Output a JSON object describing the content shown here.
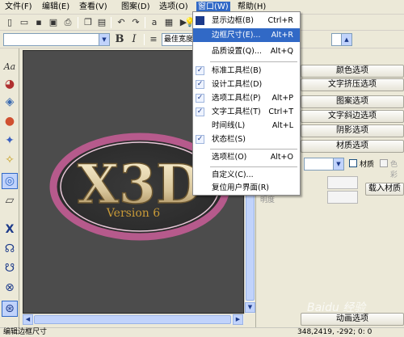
{
  "menubar": {
    "items": [
      "文件(F)",
      "编辑(E)",
      "查看(V)",
      "图案(D)",
      "选项(O)",
      "窗口(W)",
      "帮助(H)"
    ]
  },
  "toolbar2": {
    "font_combo": "",
    "style_combo": "最佳宽度",
    "bold": "B",
    "italic": "I"
  },
  "window_menu": {
    "items": [
      {
        "label": "显示边框(B)",
        "shortcut": "Ctrl+R",
        "checked": false
      },
      {
        "label": "边框尺寸(E)...",
        "shortcut": "Alt+R",
        "checked": false
      },
      {
        "label": "品质设置(Q)...",
        "shortcut": "Alt+Q",
        "checked": false
      },
      {
        "label": "标准工具栏(B)",
        "shortcut": "",
        "checked": true
      },
      {
        "label": "设计工具栏(D)",
        "shortcut": "",
        "checked": true
      },
      {
        "label": "选项工具栏(P)",
        "shortcut": "Alt+P",
        "checked": true
      },
      {
        "label": "文字工具栏(T)",
        "shortcut": "Ctrl+T",
        "checked": true
      },
      {
        "label": "时间线(L)",
        "shortcut": "Alt+L",
        "checked": false
      },
      {
        "label": "状态栏(S)",
        "shortcut": "",
        "checked": true
      },
      {
        "label": "选项栏(O)",
        "shortcut": "Alt+O",
        "checked": false
      },
      {
        "label": "自定义(C)...",
        "shortcut": "",
        "checked": false
      },
      {
        "label": "复位用户界面(R)",
        "shortcut": "",
        "checked": false
      }
    ]
  },
  "right_panel": {
    "buttons": [
      "颜色选项",
      "文字挤压选项",
      "图案选项",
      "文字斜边选项",
      "阴影选项",
      "材质选项"
    ],
    "material_checkbox": "材质",
    "color_checkbox": "色彩",
    "load_material_button": "载入材质",
    "prop_labels": [
      "角度",
      "明度"
    ],
    "animation_button": "动画选项"
  },
  "logo": {
    "text": "X3D",
    "subtitle": "Version 6"
  },
  "statusbar": {
    "left": "编辑边框尺寸",
    "coords": "348,2419, -292; 0: 0"
  },
  "watermark": "Baidu 经验",
  "colors": {
    "highlight": "#3169c6",
    "canvas_bg": "#4c4c4c"
  }
}
